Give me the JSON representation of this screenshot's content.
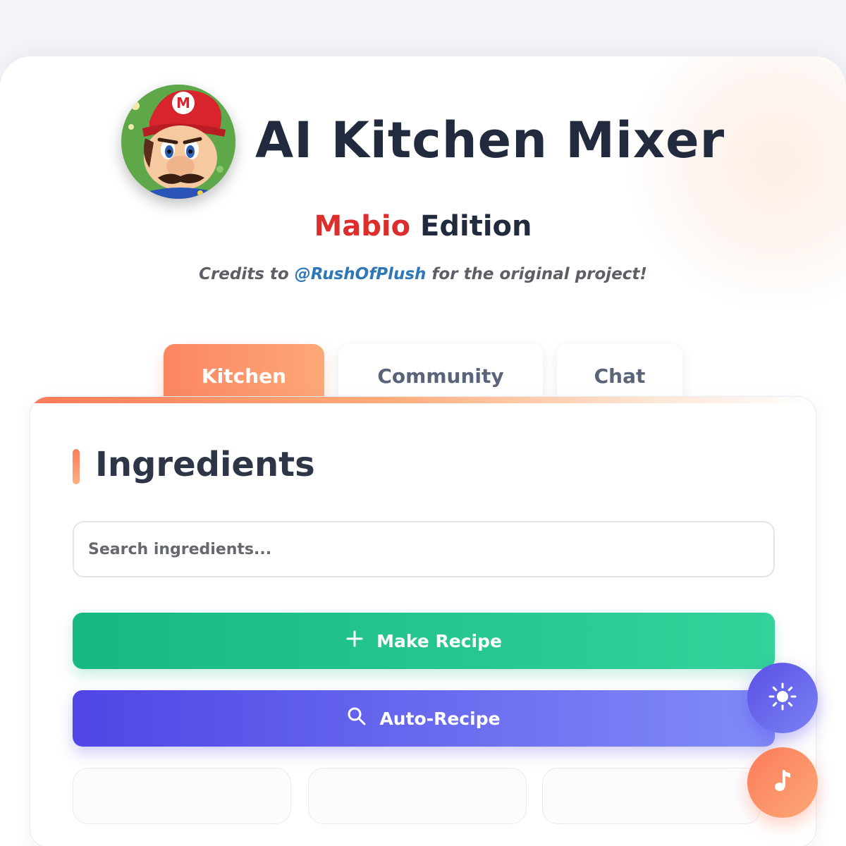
{
  "header": {
    "title": "AI Kitchen Mixer",
    "edition_highlight": "Mabio",
    "edition_rest": "Edition",
    "credits_prefix": "Credits to",
    "credits_handle": "@RushOfPlush",
    "credits_suffix": "for the original project!",
    "avatar_icon": "mario-avatar"
  },
  "tabs": [
    {
      "label": "Kitchen",
      "active": true
    },
    {
      "label": "Community",
      "active": false
    },
    {
      "label": "Chat",
      "active": false
    }
  ],
  "ingredients": {
    "title": "Ingredients",
    "search_placeholder": "Search ingredients...",
    "make_recipe_label": "Make Recipe",
    "make_recipe_icon": "plus-icon",
    "auto_recipe_label": "Auto-Recipe",
    "auto_recipe_icon": "search-icon"
  },
  "fabs": {
    "theme_icon": "sun-icon",
    "music_icon": "music-note-icon"
  },
  "colors": {
    "accent_orange": "#fb8662",
    "green": "#16b981",
    "purple": "#4f46e5",
    "title_dark": "#222b3d",
    "edition_red": "#dd2e2e",
    "link_blue": "#2e77b8"
  }
}
